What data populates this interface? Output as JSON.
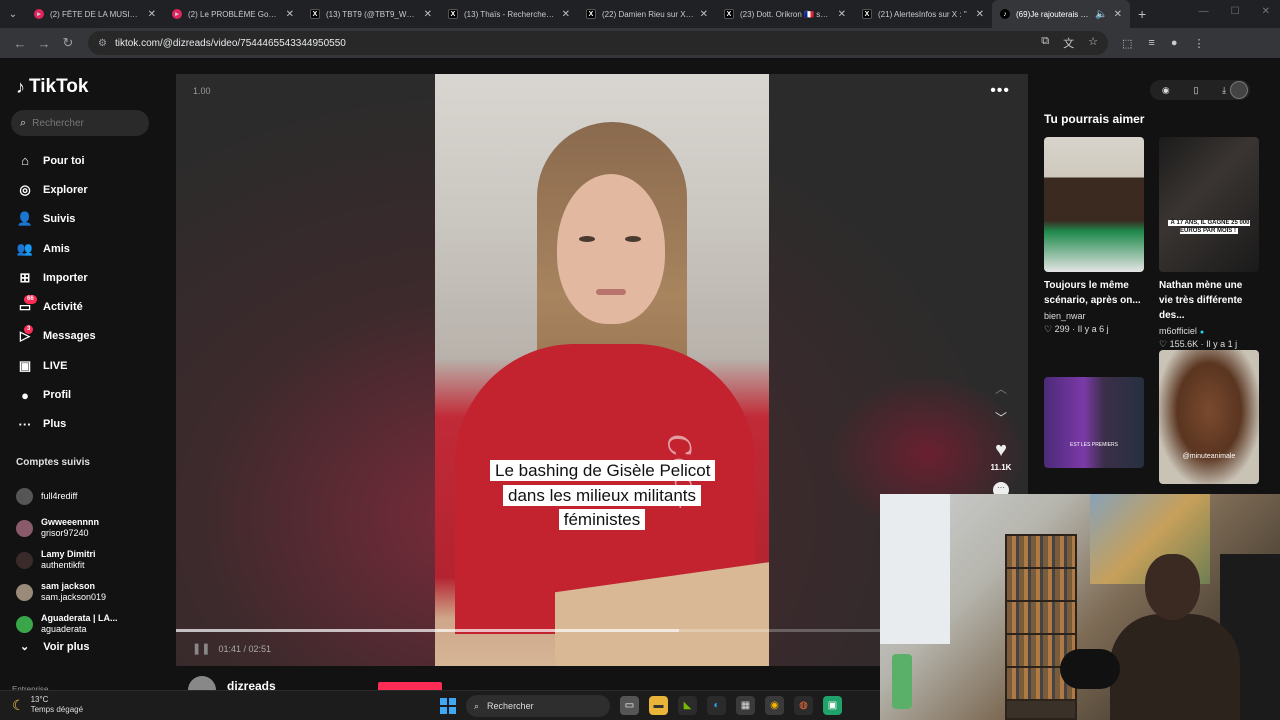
{
  "browser": {
    "tabs": [
      {
        "title": "(2) FÊTE DE LA MUSIQUE",
        "icon": "youtube-icon"
      },
      {
        "title": "(2) Le PROBLÈME God Va",
        "icon": "youtube-icon"
      },
      {
        "title": "(13) TBT9 (@TBT9_W9) / X",
        "icon": "x-icon"
      },
      {
        "title": "(13) Thaïs - Recherche / X",
        "icon": "x-icon"
      },
      {
        "title": "(22) Damien Rieu sur X : \"",
        "icon": "x-icon"
      },
      {
        "title": "(23) Dott. Orikron 🇫🇷 sur X :",
        "icon": "x-icon"
      },
      {
        "title": "(21) AlertesInfos sur X : \"",
        "icon": "x-icon"
      },
      {
        "title": "(69)Je rajouterais égal",
        "icon": "tiktok-icon",
        "active": true
      }
    ],
    "url": "tiktok.com/@dizreads/video/7544465543344950550"
  },
  "sidebar": {
    "logo": "TikTok",
    "search_placeholder": "Rechercher",
    "nav": [
      {
        "label": "Pour toi",
        "icon": "home-icon"
      },
      {
        "label": "Explorer",
        "icon": "compass-icon"
      },
      {
        "label": "Suivis",
        "icon": "following-icon"
      },
      {
        "label": "Amis",
        "icon": "friends-icon"
      },
      {
        "label": "Importer",
        "icon": "upload-icon"
      },
      {
        "label": "Activité",
        "icon": "activity-icon",
        "badge": "66"
      },
      {
        "label": "Messages",
        "icon": "messages-icon",
        "badge": "3"
      },
      {
        "label": "LIVE",
        "icon": "live-icon"
      },
      {
        "label": "Profil",
        "icon": "profile-icon"
      },
      {
        "label": "Plus",
        "icon": "more-icon"
      }
    ],
    "followed_title": "Comptes suivis",
    "followed": [
      {
        "name": "",
        "handle": "full4rediff"
      },
      {
        "name": "Gwweeennnn",
        "handle": "grisor97240"
      },
      {
        "name": "Lamy Dimitri",
        "handle": "authentikfit"
      },
      {
        "name": "sam jackson",
        "handle": "sam.jackson019"
      },
      {
        "name": "Aguaderata | LA...",
        "handle": "aguaderata"
      }
    ],
    "see_more": "Voir plus",
    "entreprise": "Entreprise"
  },
  "video": {
    "speed": "1.00",
    "caption": "Le bashing de Gisèle Pelicot dans les milieux militants féministes",
    "sweater_print": "Coca",
    "time": "01:41 / 02:51",
    "progress": 0.59,
    "likes": "11.1K",
    "author": "dizreads"
  },
  "suggestions": {
    "title": "Tu pourrais aimer",
    "cards": [
      {
        "title": "Toujours le même scénario, après on...",
        "author": "bien_nwar",
        "verified": false,
        "likes": "299",
        "age": "Il y a 6 j"
      },
      {
        "title": "Nathan mène une vie très différente des...",
        "author": "m6officiel",
        "verified": true,
        "likes": "155.6K",
        "age": "Il y a 1 j",
        "overlay": "À 17 ANS, IL GAGNE 25 000 EUROS PAR MOIS !"
      },
      {
        "overlay_label": "EST LES PREMIERS"
      },
      {
        "overlay_label": "@minuteanimale"
      }
    ]
  },
  "taskbar": {
    "temp": "13°C",
    "weather": "Temps dégagé",
    "search": "Rechercher"
  }
}
